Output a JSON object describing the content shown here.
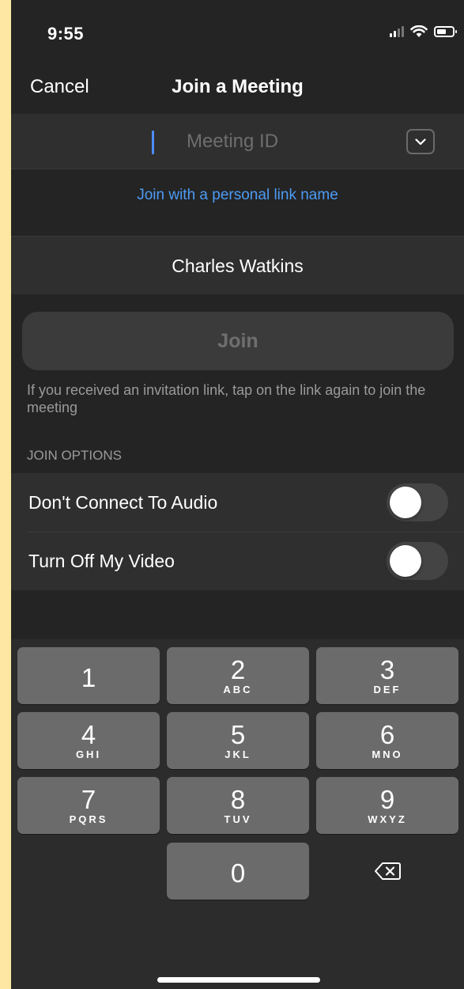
{
  "status_bar": {
    "time": "9:55"
  },
  "nav": {
    "cancel_label": "Cancel",
    "title": "Join a Meeting"
  },
  "meeting_id": {
    "placeholder": "Meeting ID",
    "value": ""
  },
  "personal_link_label": "Join with a personal link name",
  "name_field": {
    "value": "Charles Watkins"
  },
  "join_button_label": "Join",
  "invite_hint": "If you received an invitation link, tap on the link again to join the meeting",
  "join_options": {
    "header": "JOIN OPTIONS",
    "items": [
      {
        "label": "Don't Connect To Audio",
        "on": false
      },
      {
        "label": "Turn Off My Video",
        "on": false
      }
    ]
  },
  "keypad": {
    "keys": [
      {
        "digit": "1",
        "letters": ""
      },
      {
        "digit": "2",
        "letters": "ABC"
      },
      {
        "digit": "3",
        "letters": "DEF"
      },
      {
        "digit": "4",
        "letters": "GHI"
      },
      {
        "digit": "5",
        "letters": "JKL"
      },
      {
        "digit": "6",
        "letters": "MNO"
      },
      {
        "digit": "7",
        "letters": "PQRS"
      },
      {
        "digit": "8",
        "letters": "TUV"
      },
      {
        "digit": "9",
        "letters": "WXYZ"
      },
      {
        "digit": "0",
        "letters": ""
      }
    ],
    "backspace_icon": "backspace-icon"
  },
  "colors": {
    "background": "#242424",
    "link": "#4c9bf5",
    "caret": "#4d8dff",
    "key": "#6b6b6b"
  }
}
